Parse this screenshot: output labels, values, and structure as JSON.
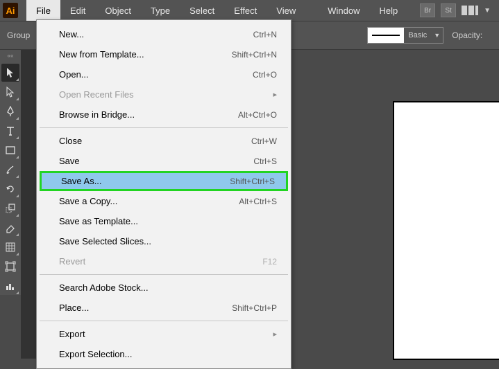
{
  "app": {
    "logo": "Ai"
  },
  "menubar": {
    "items": [
      "File",
      "Edit",
      "Object",
      "Type",
      "Select",
      "Effect",
      "View",
      "Window",
      "Help"
    ],
    "badges": [
      "Br",
      "St"
    ]
  },
  "controlbar": {
    "group_label": "Group",
    "stroke_label": "Basic",
    "opacity_label": "Opacity:"
  },
  "dropdown": {
    "items": [
      {
        "label": "New...",
        "shortcut": "Ctrl+N"
      },
      {
        "label": "New from Template...",
        "shortcut": "Shift+Ctrl+N"
      },
      {
        "label": "Open...",
        "shortcut": "Ctrl+O"
      },
      {
        "label": "Open Recent Files",
        "sub": true,
        "disabled": true
      },
      {
        "label": "Browse in Bridge...",
        "shortcut": "Alt+Ctrl+O"
      },
      {
        "sep": true
      },
      {
        "label": "Close",
        "shortcut": "Ctrl+W"
      },
      {
        "label": "Save",
        "shortcut": "Ctrl+S"
      },
      {
        "label": "Save As...",
        "shortcut": "Shift+Ctrl+S",
        "highlight": true
      },
      {
        "label": "Save a Copy...",
        "shortcut": "Alt+Ctrl+S"
      },
      {
        "label": "Save as Template..."
      },
      {
        "label": "Save Selected Slices..."
      },
      {
        "label": "Revert",
        "shortcut": "F12",
        "disabled": true
      },
      {
        "sep": true
      },
      {
        "label": "Search Adobe Stock..."
      },
      {
        "label": "Place...",
        "shortcut": "Shift+Ctrl+P"
      },
      {
        "sep": true
      },
      {
        "label": "Export",
        "sub": true
      },
      {
        "label": "Export Selection..."
      }
    ]
  },
  "tools": [
    "selection",
    "direct-selection",
    "pen",
    "type",
    "rectangle",
    "brush",
    "rotate",
    "scale",
    "eraser",
    "gradient-mesh",
    "artboard",
    "column-graph"
  ]
}
